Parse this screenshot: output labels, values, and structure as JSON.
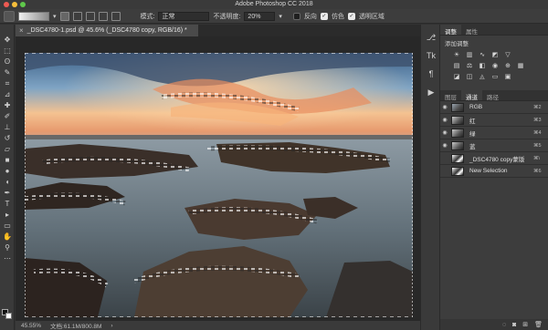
{
  "window": {
    "title": "Adobe Photoshop CC 2018"
  },
  "options": {
    "mode_label": "模式:",
    "mode_value": "正常",
    "opacity_label": "不透明度:",
    "opacity_value": "20%",
    "reverse_label": "反向",
    "dither_label": "仿色",
    "transparency_label": "透明区域",
    "reverse_checked": false,
    "dither_checked": true,
    "transparency_checked": true
  },
  "document": {
    "tab_title": "_DSC4780-1.psd @ 45.6% (_DSC4780 copy, RGB/16) *"
  },
  "status": {
    "zoom": "45.55%",
    "doc_size": "文档:61.1M/800.8M"
  },
  "panels": {
    "top_tabs": [
      "调整",
      "属性"
    ],
    "adjustments_title": "添加调整",
    "bottom_tabs": [
      "图层",
      "通道",
      "路径"
    ],
    "channels": [
      {
        "name": "RGB",
        "shortcut": "⌘2",
        "visible": true,
        "selected": false
      },
      {
        "name": "红",
        "shortcut": "⌘3",
        "visible": true,
        "selected": false
      },
      {
        "name": "绿",
        "shortcut": "⌘4",
        "visible": true,
        "selected": false
      },
      {
        "name": "蓝",
        "shortcut": "⌘5",
        "visible": true,
        "selected": false
      },
      {
        "name": "_DSC4780 copy蒙版",
        "shortcut": "⌘\\",
        "visible": false,
        "selected": false
      },
      {
        "name": "New Selection",
        "shortcut": "⌘6",
        "visible": false,
        "selected": false
      }
    ]
  },
  "colors": {
    "chrome_dark": "#323232",
    "panel": "#3d3d3d",
    "foreground_swatch": "#111111",
    "background_swatch": "#ffffff"
  }
}
